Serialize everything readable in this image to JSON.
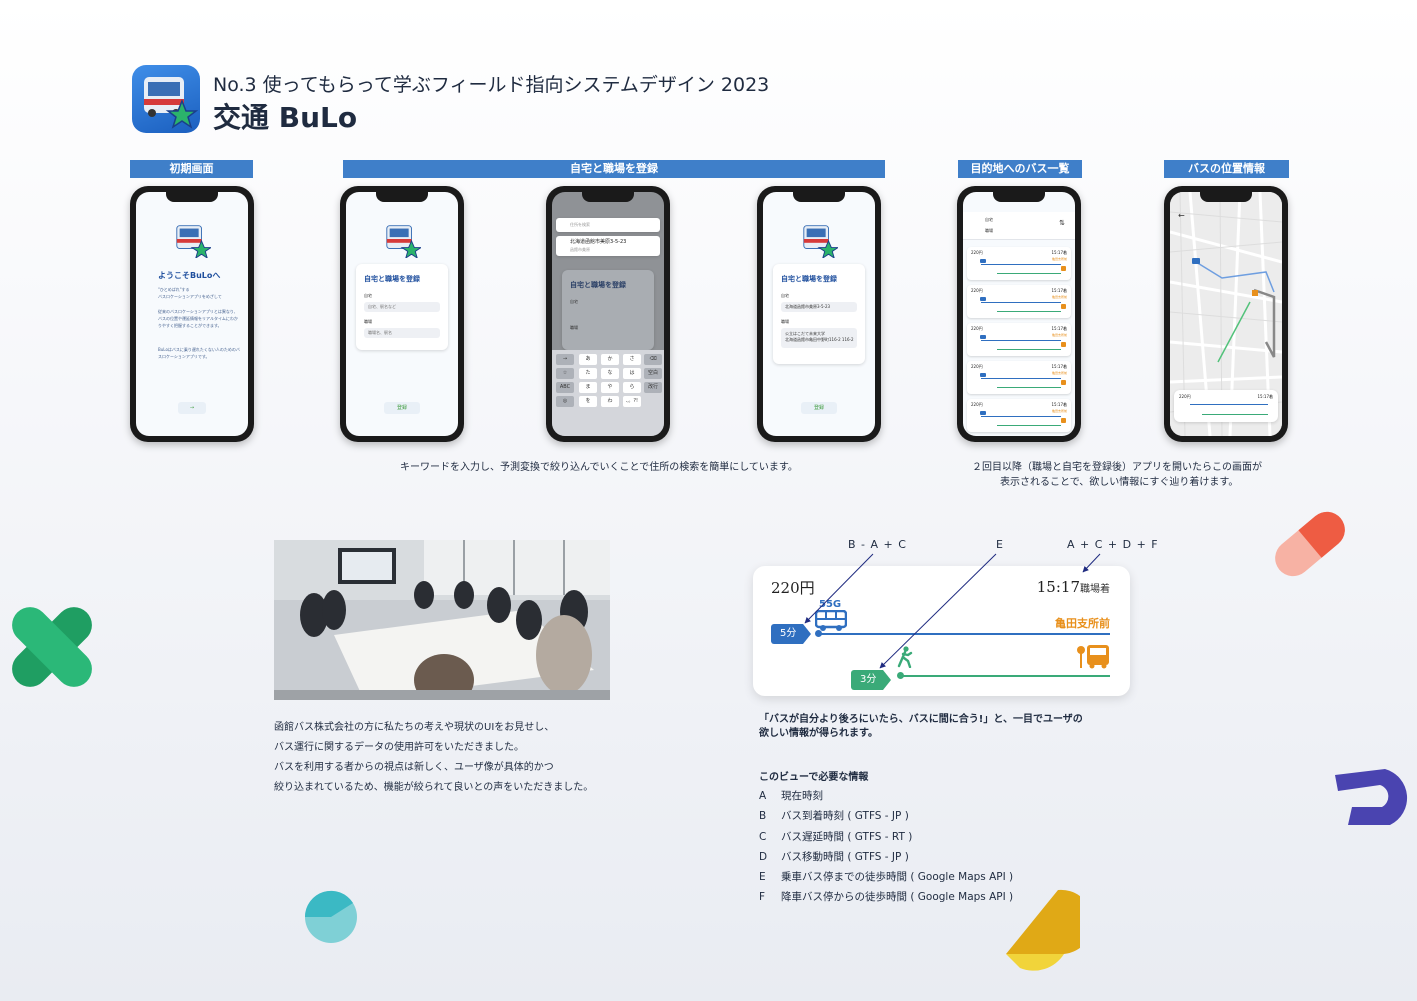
{
  "header": {
    "subtitle": "No.3 使ってもらって学ぶフィールド指向システムデザイン 2023",
    "title": "交通 BuLo"
  },
  "sections": {
    "initial": "初期画面",
    "register": "自宅と職場を登録",
    "bus_list": "目的地へのバス一覧",
    "bus_location": "バスの位置情報"
  },
  "phones": {
    "welcome_title": "ようこそBuLoへ",
    "welcome_sub": "\"ひとめばれ\"する\nバスロケーションアプリをめざして",
    "welcome_body": "従来のバスロケーションアプリとは異なり、\nバスの位置や運延情報をリアルタイムにわか\nりやすく把握することができます。",
    "welcome_body2": "BuLoはバスに乗り遅れたくない人のためのバ\nスロケーションアプリです。",
    "register_title": "自宅と職場を登録",
    "home_label": "自宅",
    "work_label": "職場",
    "home_placeholder": "自宅、駅名など",
    "work_placeholder": "職場名、駅名",
    "register_btn": "登録",
    "search_placeholder": "住所を検索",
    "search_result": "北海道函館市美原3-5-23",
    "search_result_sub": "函館市美原",
    "home_value": "北海道函館市美原3-5-23",
    "work_value": "公立はこだて未来大学\n北海道函館市亀田中野町116-2 116-2",
    "kb_keys": [
      "あ",
      "か",
      "さ",
      "た",
      "な",
      "は",
      "ま",
      "や",
      "ら",
      "を",
      "わ",
      "、。?!"
    ],
    "kb_side_left": [
      "→",
      "☆",
      "ABC",
      "◎"
    ],
    "kb_side_right": [
      "⌫",
      "空白",
      "改行"
    ],
    "list_home": "自宅",
    "list_work": "職場",
    "list_price": "220円",
    "list_time": "15:17着",
    "list_stop": "亀田支所前",
    "map_price": "220円",
    "map_time": "15:17着"
  },
  "captions": {
    "register": "キーワードを入力し、予測変換で絞り込んでいくことで住所の検索を簡単にしています。",
    "list_line1": "２回目以降（職場と自宅を登録後）アプリを開いたらこの画面が",
    "list_line2": "表示されることで、欲しい情報にすぐ辿り着けます。"
  },
  "body_text": [
    "函館バス株式会社の方に私たちの考えや現状のUIをお見せし、",
    "バス運行に関するデータの使用許可をいただきました。",
    "バスを利用する者からの視点は新しく、ユーザ像が具体的かつ",
    "絞り込まれているため、機能が絞られて良いとの声をいただきました。"
  ],
  "detail_card": {
    "annot_1": "B - A + C",
    "annot_2": "E",
    "annot_3": "A + C + D + F",
    "price": "220円",
    "arrival_time": "15:17",
    "arrival_suffix": "職場着",
    "bus_number": "55G",
    "bus_wait": "5分",
    "walk_time": "3分",
    "stop_name": "亀田支所前",
    "accent_blue": "#2f6fc0",
    "accent_green": "#3aaa78",
    "accent_orange": "#e8901c"
  },
  "quote": {
    "line1": "「バスが自分より後ろにいたら、バスに間に合う!」と、一目でユーザの",
    "line2": "欲しい情報が得られます。"
  },
  "info": {
    "title": "このビューで必要な情報",
    "items": [
      {
        "key": "A",
        "text": "現在時刻"
      },
      {
        "key": "B",
        "text": "バス到着時刻 ( GTFS - JP )"
      },
      {
        "key": "C",
        "text": "バス遅延時間 ( GTFS - RT )"
      },
      {
        "key": "D",
        "text": "バス移動時間 ( GTFS - JP )"
      },
      {
        "key": "E",
        "text": "乗車バス停までの徒歩時間 ( Google Maps API )"
      },
      {
        "key": "F",
        "text": "降車バス停からの徒歩時間 ( Google Maps API )"
      }
    ]
  }
}
